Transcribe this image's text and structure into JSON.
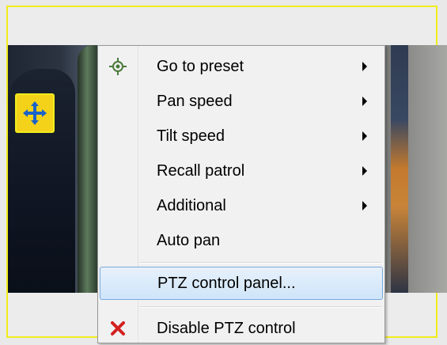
{
  "menu": {
    "items": [
      {
        "label": "Go to preset",
        "icon": "crosshair-icon",
        "submenu": true
      },
      {
        "label": "Pan speed",
        "submenu": true
      },
      {
        "label": "Tilt speed",
        "submenu": true
      },
      {
        "label": "Recall patrol",
        "submenu": true
      },
      {
        "label": "Additional",
        "submenu": true
      },
      {
        "label": "Auto pan",
        "submenu": false
      },
      {
        "label": "PTZ control panel...",
        "highlighted": true
      },
      {
        "label": "Disable PTZ control",
        "icon": "red-x-icon"
      }
    ]
  },
  "overlay": {
    "ptz_button_icon": "move-arrows-icon"
  },
  "colors": {
    "frame_border": "#f2ec1c",
    "highlight_bg": "#cfe5fa",
    "highlight_border": "#7aa9dc",
    "disable_icon": "#d32020",
    "crosshair_icon": "#4b7a3a"
  }
}
